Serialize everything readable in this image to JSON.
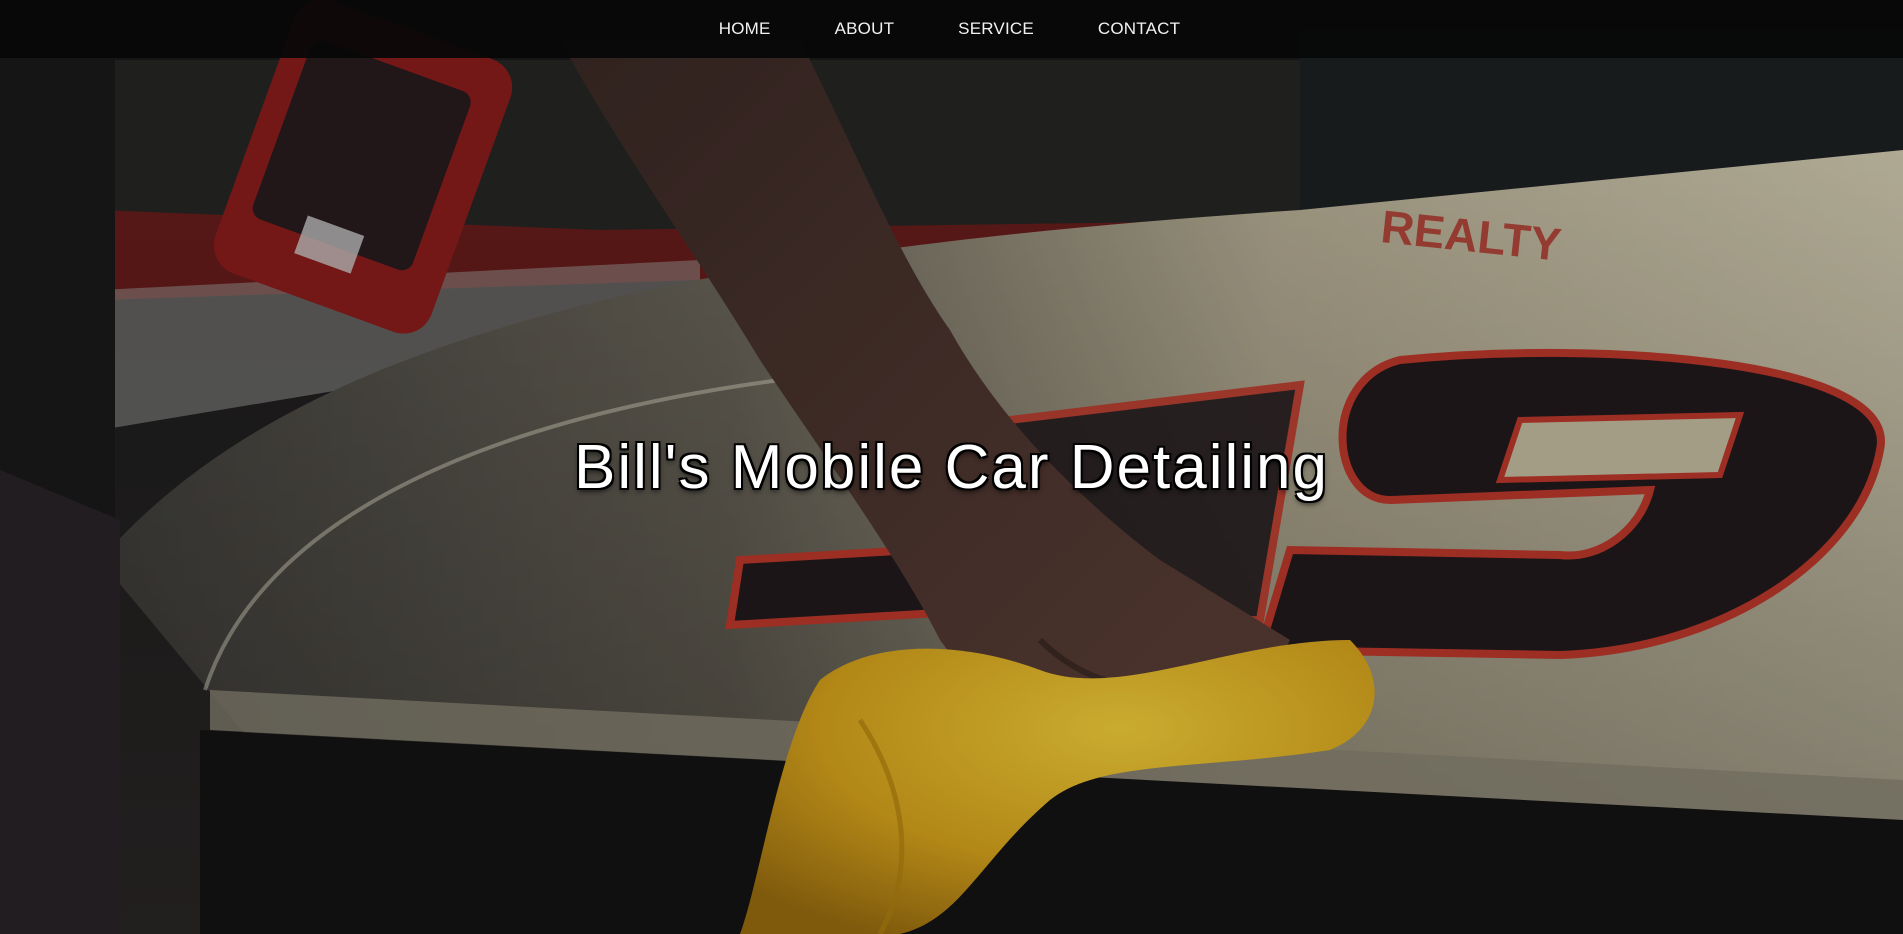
{
  "nav": {
    "items": [
      {
        "label": "HOME"
      },
      {
        "label": "ABOUT"
      },
      {
        "label": "SERVICE"
      },
      {
        "label": "CONTACT"
      }
    ]
  },
  "hero": {
    "title": "Bill's Mobile Car Detailing",
    "image_description_icon": "car-detailing-photo",
    "car_number_text": "19",
    "car_hood_text": "REALTY"
  },
  "colors": {
    "navbar_bg": "#080808",
    "hood_cream": "#c9c0a4",
    "number_dark": "#231a1d",
    "number_outline": "#c0392b",
    "towel_yellow": "#e8b820"
  }
}
